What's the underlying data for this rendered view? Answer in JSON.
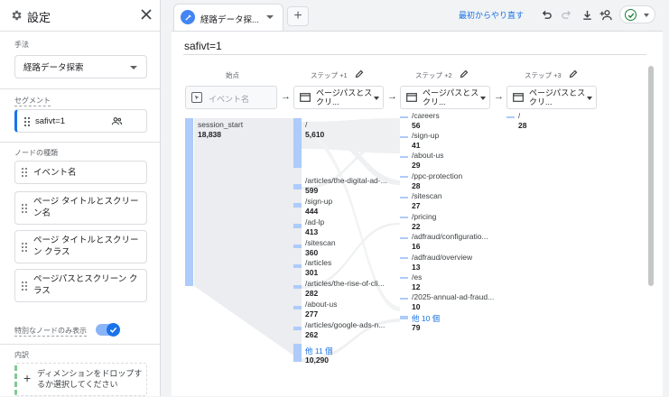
{
  "settings": {
    "title": "設定",
    "technique_label": "手法",
    "technique_value": "経路データ探索",
    "segment_label": "セグメント",
    "segment_value": "safivt=1",
    "node_types_label": "ノードの種類",
    "node_types": [
      "イベント名",
      "ページ タイトルとスクリーン名",
      "ページ タイトルとスクリーン クラス",
      "ページパスとスクリーン クラス"
    ],
    "special_nodes_label": "特別なノードのみ表示",
    "breakdown_label": "内訳",
    "drop_dimension": "ディメンションをドロップするか選択してください"
  },
  "tabs": {
    "active_label": "経路データ探...",
    "add_tab": "+"
  },
  "toolbar": {
    "restart_label": "最初からやり直す"
  },
  "canvas": {
    "segment_title": "safivt=1",
    "start_label": "始点",
    "start_placeholder": "イベント名",
    "steps": [
      {
        "label": "ステップ +1",
        "value": "ページパスとスクリ..."
      },
      {
        "label": "ステップ +2",
        "value": "ページパスとスクリ..."
      },
      {
        "label": "ステップ +3",
        "value": "ページパスとスクリ..."
      }
    ],
    "start_node": {
      "label": "session_start",
      "value": "18,838"
    },
    "step1_nodes": [
      {
        "label": "/",
        "value": "5,610"
      },
      {
        "label": "/articles/the-digital-ad-...",
        "value": "599"
      },
      {
        "label": "/sign-up",
        "value": "444"
      },
      {
        "label": "/ad-lp",
        "value": "413"
      },
      {
        "label": "/sitescan",
        "value": "360"
      },
      {
        "label": "/articles",
        "value": "301"
      },
      {
        "label": "/articles/the-rise-of-cli...",
        "value": "282"
      },
      {
        "label": "/about-us",
        "value": "277"
      },
      {
        "label": "/articles/google-ads-n...",
        "value": "262"
      }
    ],
    "step1_more": {
      "label": "他 11 個",
      "value": "10,290"
    },
    "step2_nodes": [
      {
        "label": "/careers",
        "value": "56"
      },
      {
        "label": "/sign-up",
        "value": "41"
      },
      {
        "label": "/about-us",
        "value": "29"
      },
      {
        "label": "/ppc-protection",
        "value": "28"
      },
      {
        "label": "/sitescan",
        "value": "27"
      },
      {
        "label": "/pricing",
        "value": "22"
      },
      {
        "label": "/adfraud/configuratio...",
        "value": "16"
      },
      {
        "label": "/adfraud/overview",
        "value": "13"
      },
      {
        "label": "/es",
        "value": "12"
      },
      {
        "label": "/2025-annual-ad-fraud...",
        "value": "10"
      }
    ],
    "step2_more": {
      "label": "他 10 個",
      "value": "79"
    },
    "step3_nodes": [
      {
        "label": "/",
        "value": "28"
      }
    ]
  },
  "colors": {
    "accent": "#1a73e8",
    "node_bar": "#aecbfa",
    "toggle": "#1a73e8",
    "check_green": "#188038"
  }
}
